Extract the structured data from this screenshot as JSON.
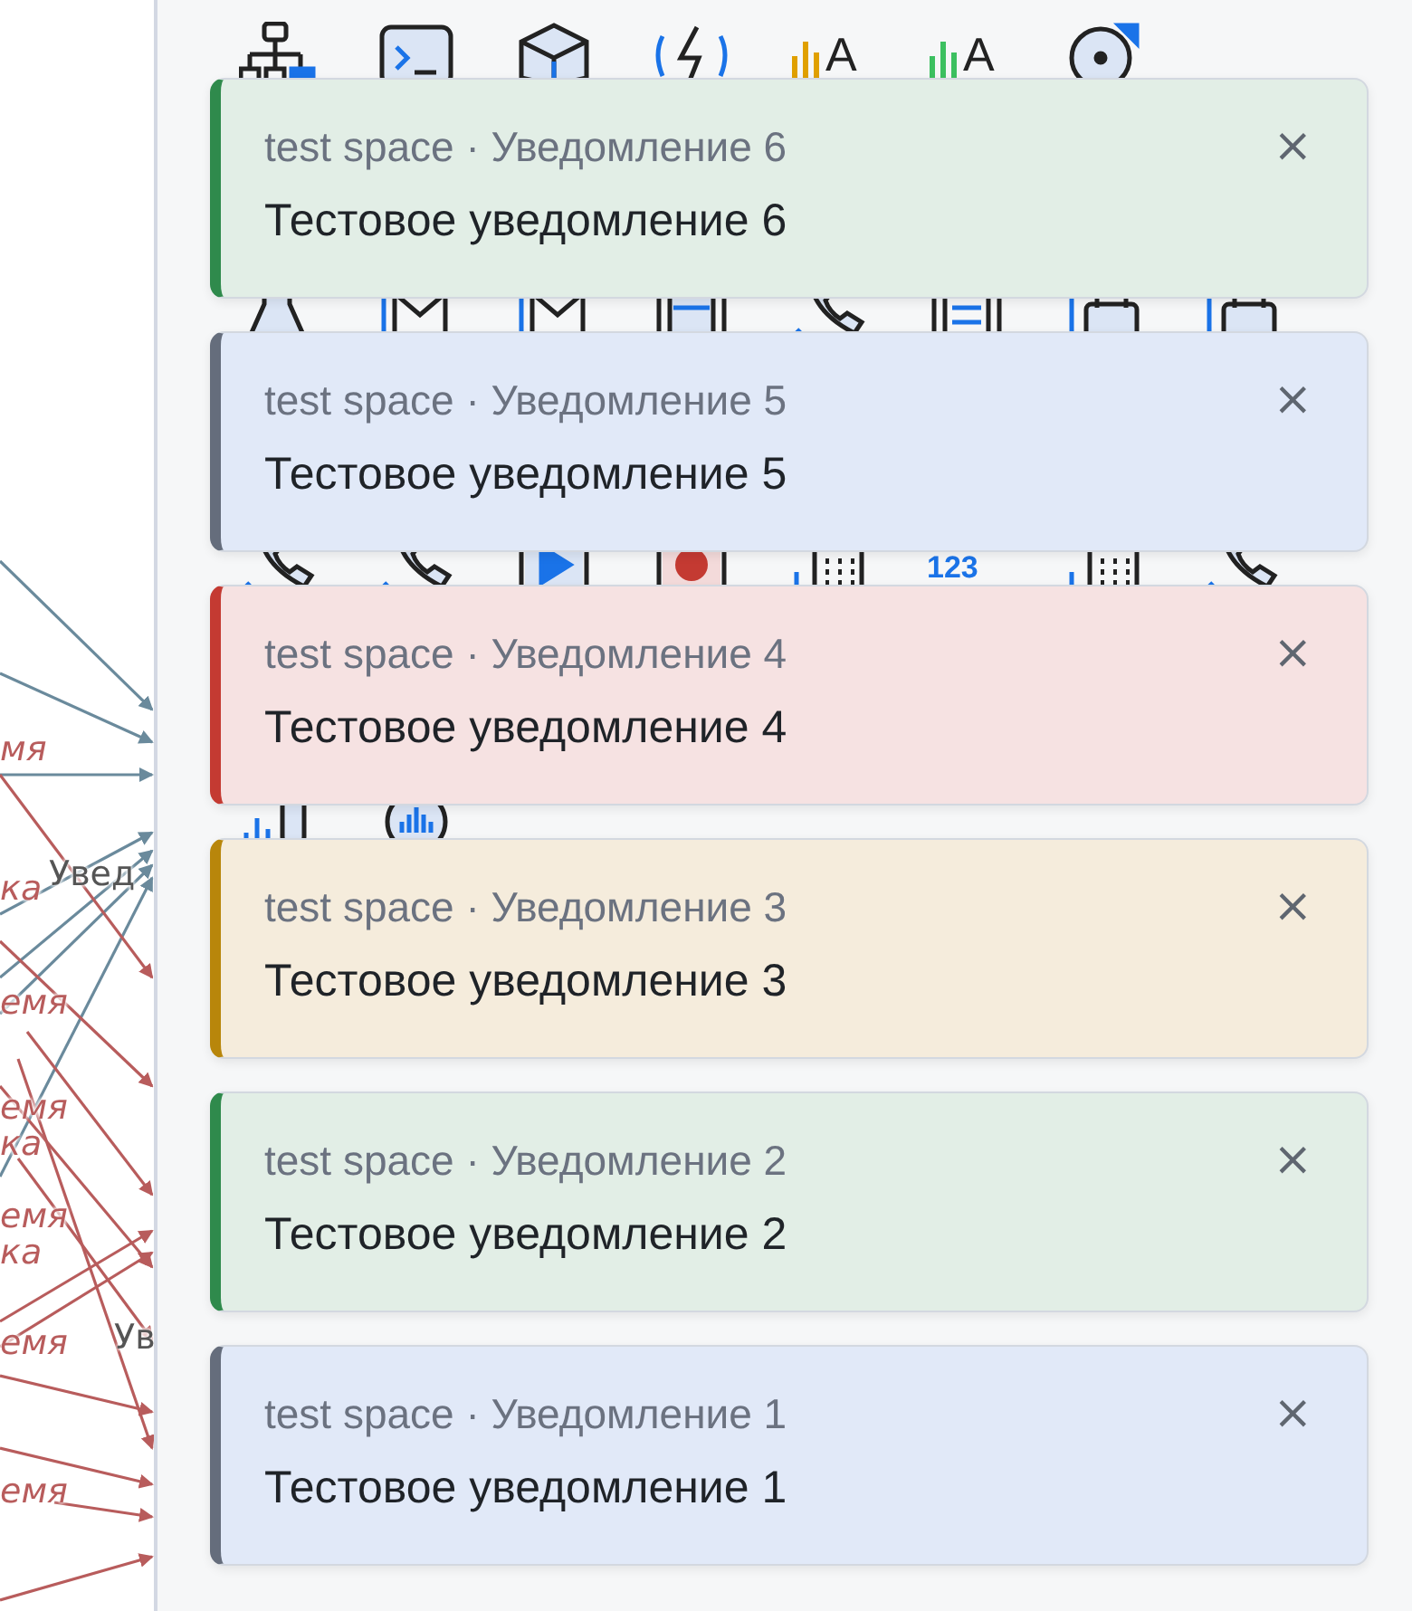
{
  "diagram": {
    "labels": [
      {
        "text": "мя",
        "kind": "edge"
      },
      {
        "text": "ка",
        "kind": "edge"
      },
      {
        "text": "Увед",
        "kind": "node"
      },
      {
        "text": "емя",
        "kind": "edge"
      },
      {
        "text": "емя",
        "kind": "edge"
      },
      {
        "text": "ка",
        "kind": "edge"
      },
      {
        "text": "емя",
        "kind": "edge"
      },
      {
        "text": "ка",
        "kind": "edge"
      },
      {
        "text": "емя",
        "kind": "edge"
      },
      {
        "text": "Ув",
        "kind": "node"
      },
      {
        "text": "емя",
        "kind": "edge"
      }
    ]
  },
  "icon_grid": [
    {
      "kind": "sitemap"
    },
    {
      "kind": "terminal"
    },
    {
      "kind": "cube"
    },
    {
      "kind": "bolt"
    },
    {
      "kind": "bars-letter",
      "text": "A",
      "color": "#e0a000"
    },
    {
      "kind": "bars-letter",
      "text": "A",
      "color": "#3cc060"
    },
    {
      "kind": "disc"
    },
    {
      "kind": "blank"
    },
    {
      "kind": "flask"
    },
    {
      "kind": "mail"
    },
    {
      "kind": "mail"
    },
    {
      "kind": "tape"
    },
    {
      "kind": "phone"
    },
    {
      "kind": "transfer"
    },
    {
      "kind": "calendar"
    },
    {
      "kind": "calendar"
    },
    {
      "kind": "phone"
    },
    {
      "kind": "phone"
    },
    {
      "kind": "play"
    },
    {
      "kind": "record"
    },
    {
      "kind": "keypad"
    },
    {
      "kind": "numbers",
      "text": "123"
    },
    {
      "kind": "keypad"
    },
    {
      "kind": "phone"
    },
    {
      "kind": "mic"
    },
    {
      "kind": "audio"
    }
  ],
  "notifications": [
    {
      "kind": "success",
      "header": "test space · Уведомление 6",
      "message": "Тестовое уведомление 6",
      "close": "×"
    },
    {
      "kind": "info",
      "header": "test space · Уведомление 5",
      "message": "Тестовое уведомление 5",
      "close": "×"
    },
    {
      "kind": "error",
      "header": "test space · Уведомление 4",
      "message": "Тестовое уведомление 4",
      "close": "×"
    },
    {
      "kind": "warning",
      "header": "test space · Уведомление 3",
      "message": "Тестовое уведомление 3",
      "close": "×"
    },
    {
      "kind": "success",
      "header": "test space · Уведомление 2",
      "message": "Тестовое уведомление 2",
      "close": "×"
    },
    {
      "kind": "info",
      "header": "test space · Уведомление 1",
      "message": "Тестовое уведомление 1",
      "close": "×"
    }
  ]
}
